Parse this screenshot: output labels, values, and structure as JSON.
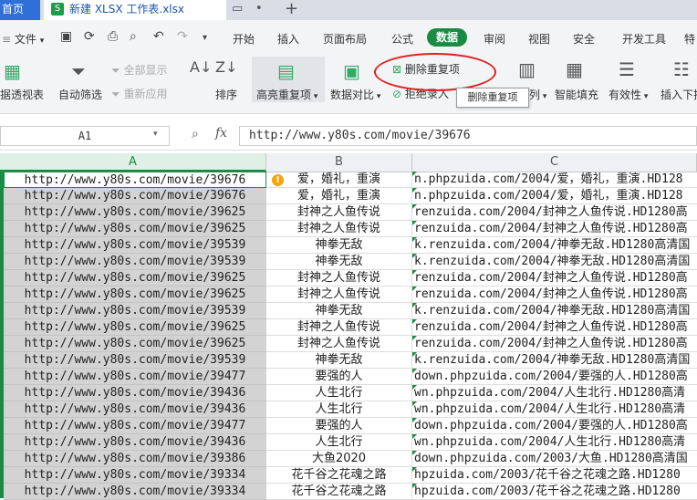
{
  "titlebar": {
    "home_tab": "首页",
    "doc_tab": "新建 XLSX 工作表.xlsx",
    "doc_icon": "S",
    "add_tab": "+"
  },
  "menubar": {
    "file": "文件",
    "items": [
      "开始",
      "插入",
      "页面布局",
      "公式",
      "数据",
      "审阅",
      "视图",
      "安全",
      "开发工具",
      "特"
    ]
  },
  "ribbon": {
    "pivot": "据透视表",
    "autofilter": "自动筛选",
    "show_all": "全部显示",
    "reapply": "重新应用",
    "sort": "排序",
    "highlight_dup": "高亮重复项",
    "data_compare": "数据对比",
    "remove_dup": "删除重复项",
    "reject_input": "拒绝录入",
    "split_col": "列",
    "smart_fill": "智能填充",
    "validity": "有效性",
    "insert_dropdown": "插入下拉"
  },
  "tooltip": "删除重复项",
  "formula_bar": {
    "cell_ref": "A1",
    "fx": "fx",
    "value": "http://www.y80s.com/movie/39676"
  },
  "columns": [
    "A",
    "B",
    "C"
  ],
  "rows": [
    {
      "a": "http://www.y80s.com/movie/39676",
      "b": "爱，婚礼，重演",
      "c": "n.phpzuida.com/2004/爱，婚礼，重演.HD128"
    },
    {
      "a": "http://www.y80s.com/movie/39676",
      "b": "爱，婚礼，重演",
      "c": "n.phpzuida.com/2004/爱，婚礼，重演.HD128"
    },
    {
      "a": "http://www.y80s.com/movie/39625",
      "b": "封神之人鱼传说",
      "c": "renzuida.com/2004/封神之人鱼传说.HD1280高"
    },
    {
      "a": "http://www.y80s.com/movie/39625",
      "b": "封神之人鱼传说",
      "c": "renzuida.com/2004/封神之人鱼传说.HD1280高"
    },
    {
      "a": "http://www.y80s.com/movie/39539",
      "b": "神拳无敌",
      "c": "k.renzuida.com/2004/神拳无敌.HD1280高清国"
    },
    {
      "a": "http://www.y80s.com/movie/39539",
      "b": "神拳无敌",
      "c": "k.renzuida.com/2004/神拳无敌.HD1280高清国"
    },
    {
      "a": "http://www.y80s.com/movie/39625",
      "b": "封神之人鱼传说",
      "c": "renzuida.com/2004/封神之人鱼传说.HD1280高"
    },
    {
      "a": "http://www.y80s.com/movie/39625",
      "b": "封神之人鱼传说",
      "c": "renzuida.com/2004/封神之人鱼传说.HD1280高"
    },
    {
      "a": "http://www.y80s.com/movie/39539",
      "b": "神拳无敌",
      "c": "k.renzuida.com/2004/神拳无敌.HD1280高清国"
    },
    {
      "a": "http://www.y80s.com/movie/39625",
      "b": "封神之人鱼传说",
      "c": "renzuida.com/2004/封神之人鱼传说.HD1280高"
    },
    {
      "a": "http://www.y80s.com/movie/39625",
      "b": "封神之人鱼传说",
      "c": "renzuida.com/2004/封神之人鱼传说.HD1280高"
    },
    {
      "a": "http://www.y80s.com/movie/39539",
      "b": "神拳无敌",
      "c": "k.renzuida.com/2004/神拳无敌.HD1280高清国"
    },
    {
      "a": "http://www.y80s.com/movie/39477",
      "b": "要强的人",
      "c": "down.phpzuida.com/2004/要强的人.HD1280高"
    },
    {
      "a": "http://www.y80s.com/movie/39436",
      "b": "人生北行",
      "c": "wn.phpzuida.com/2004/人生北行.HD1280高清"
    },
    {
      "a": "http://www.y80s.com/movie/39436",
      "b": "人生北行",
      "c": "wn.phpzuida.com/2004/人生北行.HD1280高清"
    },
    {
      "a": "http://www.y80s.com/movie/39477",
      "b": "要强的人",
      "c": "down.phpzuida.com/2004/要强的人.HD1280高"
    },
    {
      "a": "http://www.y80s.com/movie/39436",
      "b": "人生北行",
      "c": "wn.phpzuida.com/2004/人生北行.HD1280高清"
    },
    {
      "a": "http://www.y80s.com/movie/39386",
      "b": "大鱼2020",
      "c": "down.phpzuida.com/2003/大鱼.HD1280高清国"
    },
    {
      "a": "http://www.y80s.com/movie/39334",
      "b": "花千谷之花魂之路",
      "c": "hpzuida.com/2003/花千谷之花魂之路.HD1280"
    },
    {
      "a": "http://www.y80s.com/movie/39334",
      "b": "花千谷之花魂之路",
      "c": "hpzuida.com/2003/花千谷之花魂之路.HD1280"
    }
  ]
}
